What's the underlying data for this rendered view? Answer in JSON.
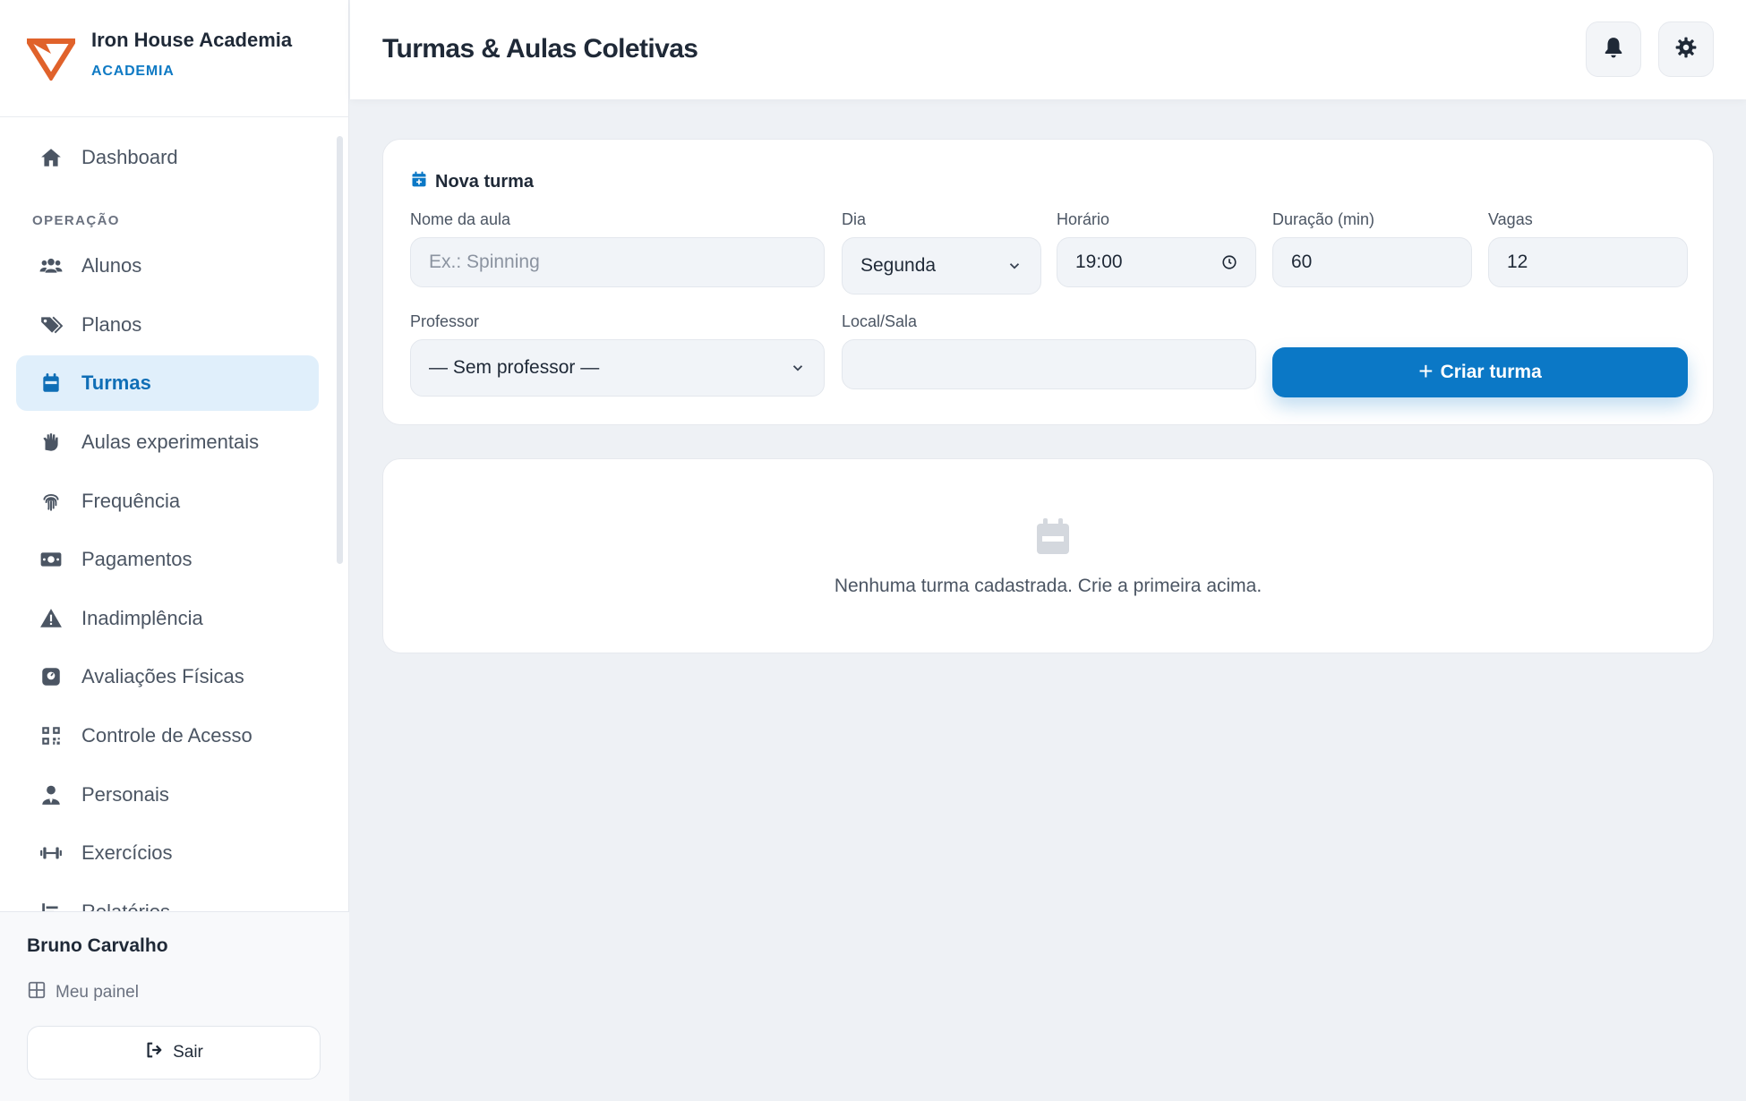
{
  "brand": {
    "name": "Iron House Academia",
    "subtitle": "ACADEMIA"
  },
  "colors": {
    "accent": "#0b78c6",
    "logo_orange": "#e0622b",
    "active_bg": "#e0effb"
  },
  "sidebar": {
    "items": [
      {
        "label": "Dashboard",
        "icon": "home-icon"
      },
      {
        "label": "Alunos",
        "icon": "users-icon"
      },
      {
        "label": "Planos",
        "icon": "tags-icon"
      },
      {
        "label": "Turmas",
        "icon": "calendar-icon",
        "active": true
      },
      {
        "label": "Aulas experimentais",
        "icon": "hand-icon"
      },
      {
        "label": "Frequência",
        "icon": "fingerprint-icon"
      },
      {
        "label": "Pagamentos",
        "icon": "money-icon"
      },
      {
        "label": "Inadimplência",
        "icon": "warning-icon"
      },
      {
        "label": "Avaliações Físicas",
        "icon": "scale-icon"
      },
      {
        "label": "Controle de Acesso",
        "icon": "qrcode-icon"
      },
      {
        "label": "Personais",
        "icon": "trainer-icon"
      },
      {
        "label": "Exercícios",
        "icon": "dumbbell-icon"
      },
      {
        "label": "Relatórios",
        "icon": "chart-icon"
      }
    ],
    "section_operacao": "OPERAÇÃO"
  },
  "footer": {
    "user_name": "Bruno Carvalho",
    "my_panel": "Meu painel",
    "logout": "Sair"
  },
  "header": {
    "title": "Turmas & Aulas Coletivas"
  },
  "form": {
    "title": "Nova turma",
    "name_label": "Nome da aula",
    "name_placeholder": "Ex.: Spinning",
    "day_label": "Dia",
    "day_value": "Segunda",
    "time_label": "Horário",
    "time_value": "19:00",
    "duration_label": "Duração (min)",
    "duration_value": "60",
    "slots_label": "Vagas",
    "slots_value": "12",
    "teacher_label": "Professor",
    "teacher_value": "— Sem professor —",
    "room_label": "Local/Sala",
    "room_value": "",
    "submit": "Criar turma"
  },
  "empty": {
    "text": "Nenhuma turma cadastrada. Crie a primeira acima."
  }
}
